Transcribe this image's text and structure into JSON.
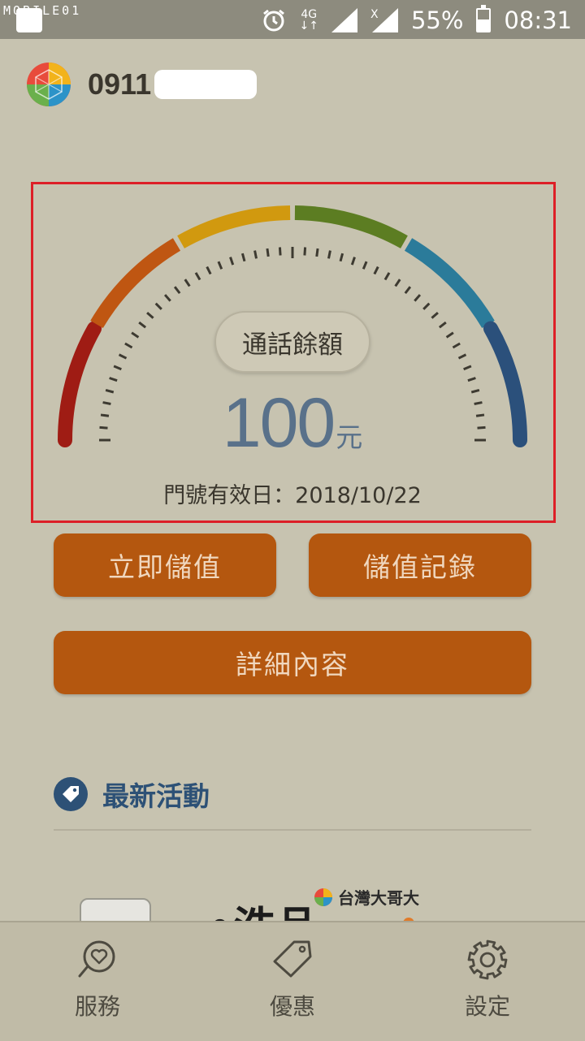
{
  "status_bar": {
    "watermark": "MOBILE01",
    "network": "4G",
    "battery": "55%",
    "battery_level": 0.55,
    "time": "08:31"
  },
  "account": {
    "number_prefix": "0911"
  },
  "gauge": {
    "label": "通話餘額",
    "amount": "100",
    "unit": "元",
    "validity": "門號有效日：2018/10/22",
    "arc_colors": [
      "#9f1c14",
      "#bf5612",
      "#d1990f",
      "#5c7d22",
      "#2b7b9a",
      "#2b507b"
    ],
    "highlight_color": "#dd1f27"
  },
  "actions": {
    "topup": "立即儲值",
    "history": "儲值記錄",
    "details": "詳細內容"
  },
  "promotions": {
    "title": "最新活動",
    "banner_brand": "台灣大哥大"
  },
  "nav": [
    {
      "label": "服務",
      "icon": "heart-chat-icon"
    },
    {
      "label": "優惠",
      "icon": "tag-icon"
    },
    {
      "label": "設定",
      "icon": "gear-icon"
    }
  ],
  "colors": {
    "accent": "#b4570f",
    "button_text": "#f0d7be",
    "amount": "#59718a",
    "section": "#2d5176",
    "background": "#c7c3b0"
  }
}
